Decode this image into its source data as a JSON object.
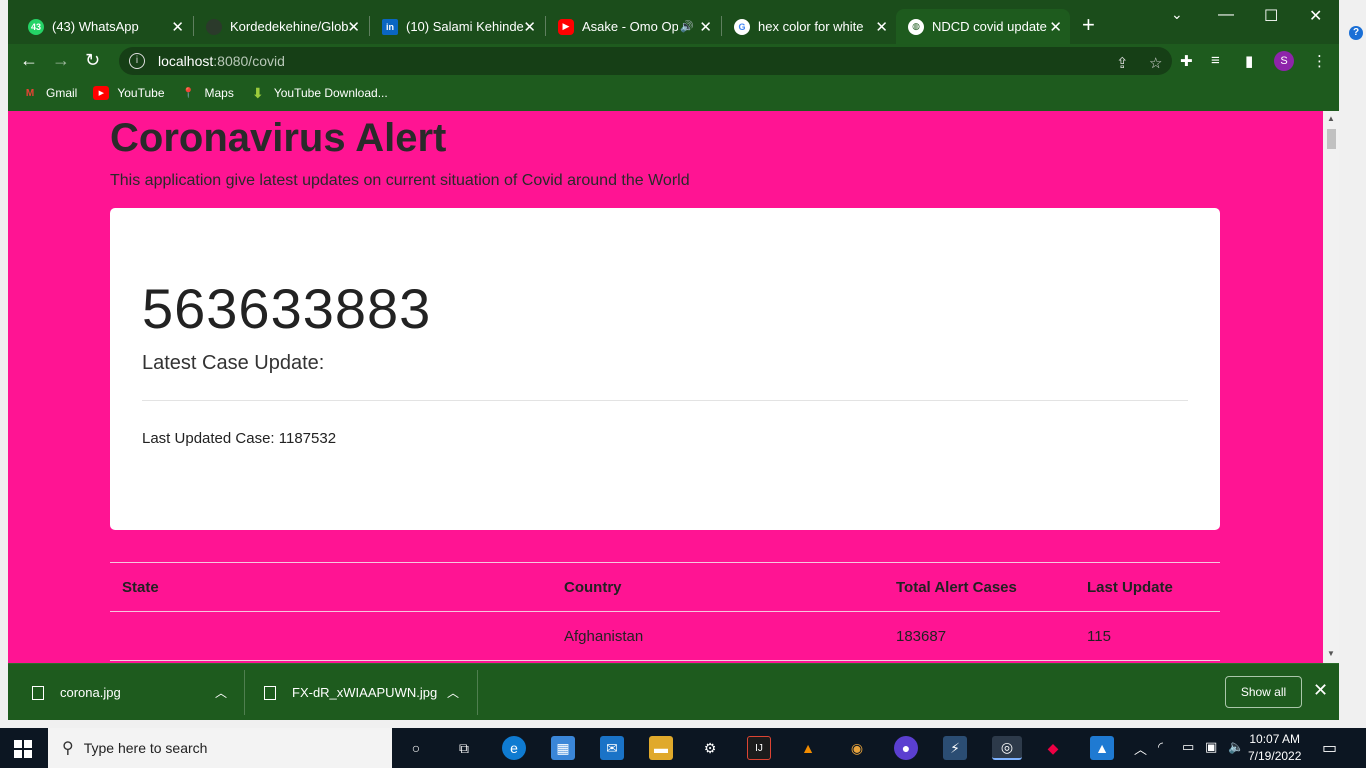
{
  "browser": {
    "tabs": [
      {
        "title": "(43) WhatsApp",
        "icon": "whatsapp-icon",
        "badge": "43"
      },
      {
        "title": "Kordedekehine/Glob",
        "icon": "github-icon"
      },
      {
        "title": "(10) Salami Kehinde",
        "icon": "linkedin-icon"
      },
      {
        "title": "Asake - Omo Op",
        "icon": "youtube-icon"
      },
      {
        "title": "hex color for white -",
        "icon": "google-icon"
      },
      {
        "title": "NDCD covid update",
        "icon": "globe-icon",
        "active": true
      }
    ],
    "url_host": "localhost",
    "url_path": ":8080/covid",
    "profile_initial": "S",
    "bookmarks": [
      {
        "label": "Gmail",
        "icon": "gmail-icon"
      },
      {
        "label": "YouTube",
        "icon": "youtube-icon"
      },
      {
        "label": "Maps",
        "icon": "maps-icon"
      },
      {
        "label": "YouTube Download...",
        "icon": "download-icon"
      }
    ]
  },
  "page": {
    "title": "Coronavirus Alert",
    "subtitle": "This application give latest updates on current situation of Covid around the World",
    "total_cases": "563633883",
    "lead": "Latest Case Update:",
    "last_updated": "Last Updated Case: 1187532",
    "background_color": "#ff1493",
    "table": {
      "headers": [
        "State",
        "Country",
        "Total Alert Cases",
        "Last Update"
      ],
      "rows": [
        [
          "",
          "Afghanistan",
          "183687",
          "115"
        ]
      ]
    }
  },
  "downloads": {
    "items": [
      "corona.jpg",
      "FX-dR_xWIAAPUWN.jpg"
    ],
    "show_all": "Show all"
  },
  "taskbar": {
    "search_placeholder": "Type here to search",
    "time": "10:07 AM",
    "date": "7/19/2022"
  }
}
